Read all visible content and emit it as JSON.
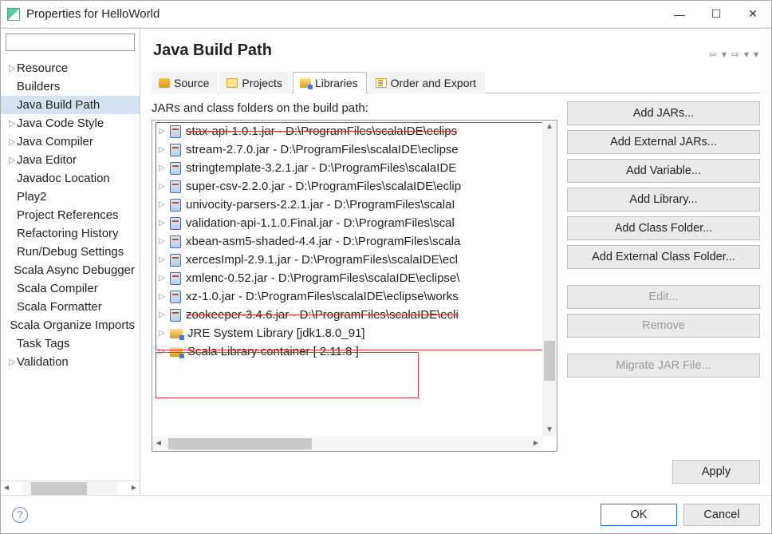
{
  "window": {
    "title": "Properties for HelloWorld"
  },
  "sidebar": {
    "items": [
      {
        "label": "Resource",
        "expandable": true
      },
      {
        "label": "Builders",
        "expandable": false
      },
      {
        "label": "Java Build Path",
        "expandable": false,
        "selected": true
      },
      {
        "label": "Java Code Style",
        "expandable": true
      },
      {
        "label": "Java Compiler",
        "expandable": true
      },
      {
        "label": "Java Editor",
        "expandable": true
      },
      {
        "label": "Javadoc Location",
        "expandable": false
      },
      {
        "label": "Play2",
        "expandable": false
      },
      {
        "label": "Project References",
        "expandable": false
      },
      {
        "label": "Refactoring History",
        "expandable": false
      },
      {
        "label": "Run/Debug Settings",
        "expandable": false
      },
      {
        "label": "Scala Async Debugger",
        "expandable": false
      },
      {
        "label": "Scala Compiler",
        "expandable": false
      },
      {
        "label": "Scala Formatter",
        "expandable": false
      },
      {
        "label": "Scala Organize Imports",
        "expandable": false
      },
      {
        "label": "Task Tags",
        "expandable": false
      },
      {
        "label": "Validation",
        "expandable": true
      }
    ]
  },
  "main": {
    "heading": "Java Build Path",
    "tabs": [
      {
        "label": "Source"
      },
      {
        "label": "Projects"
      },
      {
        "label": "Libraries",
        "active": true
      },
      {
        "label": "Order and Export"
      }
    ],
    "list_label": "JARs and class folders on the build path:",
    "jars": [
      {
        "label": "stax-api-1.0.1.jar - D:\\ProgramFiles\\scalaIDE\\eclips",
        "strike": true,
        "icon": "jar"
      },
      {
        "label": "stream-2.7.0.jar - D:\\ProgramFiles\\scalaIDE\\eclipse",
        "icon": "jar"
      },
      {
        "label": "stringtemplate-3.2.1.jar - D:\\ProgramFiles\\scalaIDE",
        "icon": "jar"
      },
      {
        "label": "super-csv-2.2.0.jar - D:\\ProgramFiles\\scalaIDE\\eclip",
        "icon": "jar"
      },
      {
        "label": "univocity-parsers-2.2.1.jar - D:\\ProgramFiles\\scalaI",
        "icon": "jar"
      },
      {
        "label": "validation-api-1.1.0.Final.jar - D:\\ProgramFiles\\scal",
        "icon": "jar"
      },
      {
        "label": "xbean-asm5-shaded-4.4.jar - D:\\ProgramFiles\\scala",
        "icon": "jar"
      },
      {
        "label": "xercesImpl-2.9.1.jar - D:\\ProgramFiles\\scalaIDE\\ecl",
        "icon": "jar"
      },
      {
        "label": "xmlenc-0.52.jar - D:\\ProgramFiles\\scalaIDE\\eclipse\\",
        "icon": "jar"
      },
      {
        "label": "xz-1.0.jar - D:\\ProgramFiles\\scalaIDE\\eclipse\\works",
        "icon": "jar"
      },
      {
        "label": "zookeeper-3.4.6.jar - D:\\ProgramFiles\\scalaIDE\\ecli",
        "strike": true,
        "icon": "jar"
      },
      {
        "label": "JRE System Library [jdk1.8.0_91]",
        "icon": "lib"
      },
      {
        "label": "Scala Library container [ 2.11.8 ]",
        "icon": "lib"
      }
    ],
    "buttons": {
      "add_jars": "Add JARs...",
      "add_ext_jars": "Add External JARs...",
      "add_variable": "Add Variable...",
      "add_library": "Add Library...",
      "add_class_folder": "Add Class Folder...",
      "add_ext_class_folder": "Add External Class Folder...",
      "edit": "Edit...",
      "remove": "Remove",
      "migrate": "Migrate JAR File..."
    },
    "apply": "Apply"
  },
  "footer": {
    "ok": "OK",
    "cancel": "Cancel"
  }
}
